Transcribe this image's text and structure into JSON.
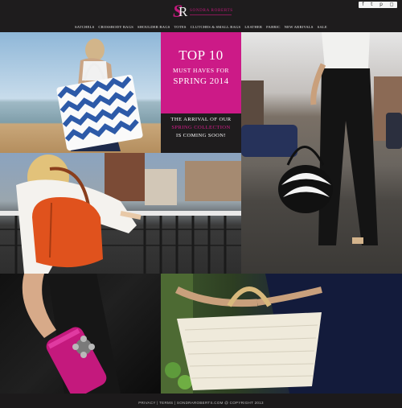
{
  "brand": {
    "logo_s": "S",
    "logo_r": "R",
    "name": "SONDRA ROBERTS",
    "accent_color": "#cc1a87"
  },
  "utility_icons": [
    "facebook-icon",
    "twitter-icon",
    "pinterest-icon",
    "instagram-icon"
  ],
  "nav": {
    "items": [
      "SATCHELS",
      "CROSSBODY BAGS",
      "SHOULDER BAGS",
      "TOTES",
      "CLUTCHES & SMALL BAGS",
      "LEATHER",
      "FABRIC",
      "NEW ARRIVALS",
      "SALE"
    ]
  },
  "promo": {
    "line1": "TOP 10",
    "line2": "MUST HAVES FOR",
    "line3": "SPRING 2014",
    "sub1": "THE ARRIVAL OF OUR",
    "sub2": "SPRING COLLECTION",
    "sub3": "IS COMING SOON!"
  },
  "footer": {
    "text": "PRIVACY  |  TERMS  |  SONDRAROBERTS.COM @ COPYRIGHT 2013"
  }
}
